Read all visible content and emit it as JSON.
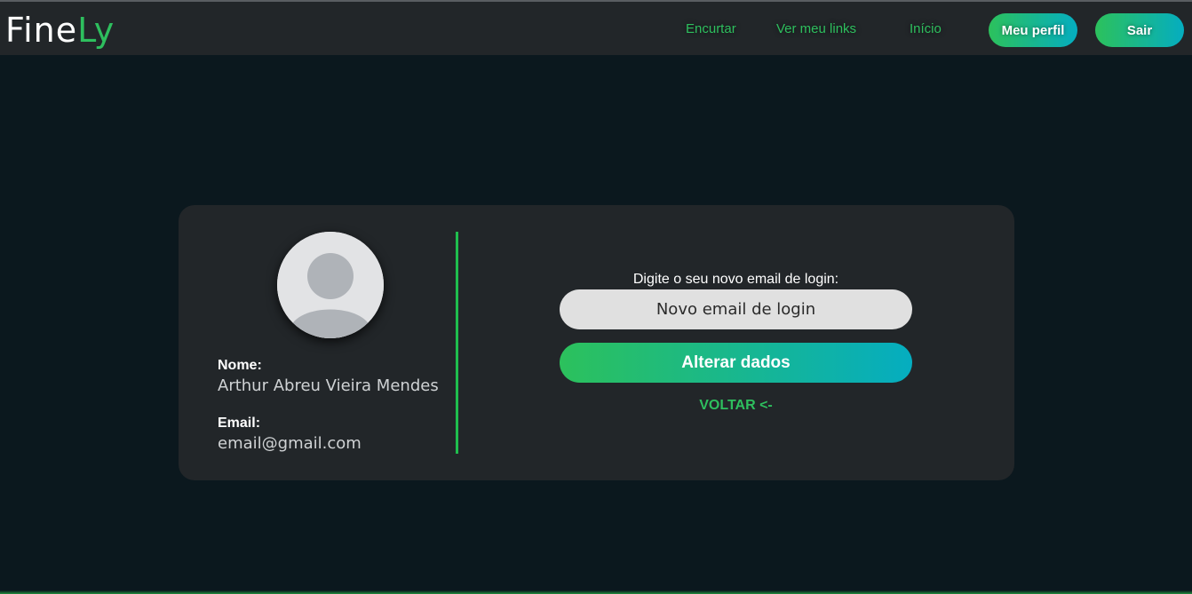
{
  "header": {
    "logo_main": "Fine",
    "logo_accent": "Ly",
    "nav": {
      "shorten": "Encurtar",
      "my_links": "Ver meu links",
      "home": "Início"
    },
    "profile_button": "Meu perfil",
    "logout_button": "Sair"
  },
  "profile": {
    "name_label": "Nome:",
    "name_value": "Arthur Abreu Vieira Mendes",
    "email_label": "Email:",
    "email_value": "email@gmail.com"
  },
  "form": {
    "prompt": "Digite o seu novo email de login:",
    "email_placeholder": "Novo email de login",
    "submit_label": "Alterar dados",
    "back_label": "VOLTAR <-"
  },
  "colors": {
    "accent_green": "#2ebf5e",
    "gradient_start": "#2cc15c",
    "gradient_end": "#05adc0",
    "background": "#0b181e",
    "panel": "#222629"
  },
  "icons": {
    "avatar": "user-avatar-placeholder-icon"
  }
}
